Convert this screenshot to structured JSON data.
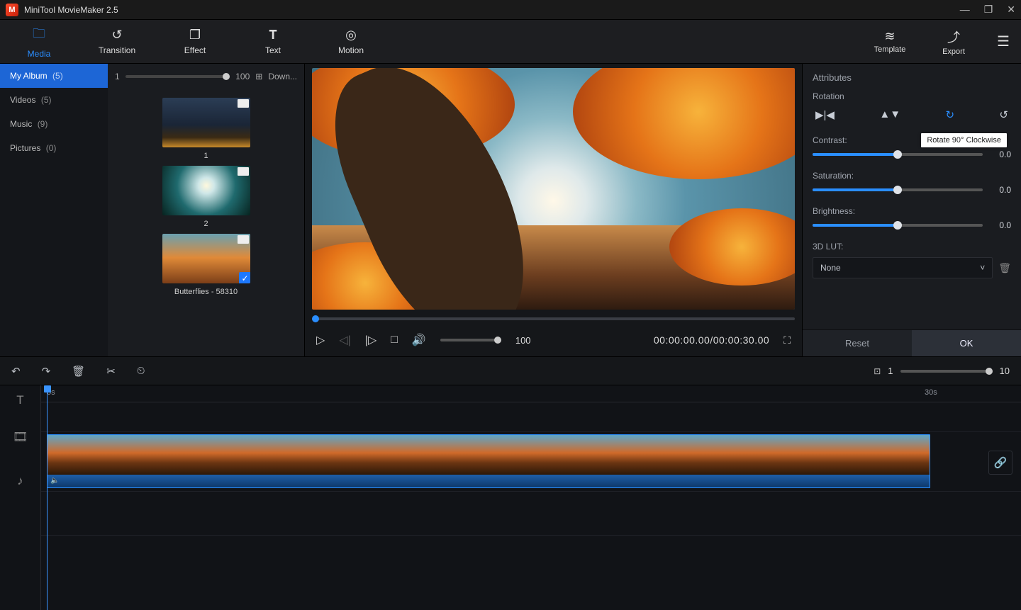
{
  "app": {
    "title": "MiniTool MovieMaker 2.5"
  },
  "tabs": {
    "media": {
      "label": "Media"
    },
    "transition": {
      "label": "Transition"
    },
    "effect": {
      "label": "Effect"
    },
    "text": {
      "label": "Text"
    },
    "motion": {
      "label": "Motion"
    }
  },
  "rightcmds": {
    "template": {
      "label": "Template"
    },
    "export": {
      "label": "Export"
    }
  },
  "sidebar": {
    "items": [
      {
        "label": "My Album",
        "count": "(5)"
      },
      {
        "label": "Videos",
        "count": "(5)"
      },
      {
        "label": "Music",
        "count": "(9)"
      },
      {
        "label": "Pictures",
        "count": "(0)"
      }
    ]
  },
  "mediaheader": {
    "left": "1",
    "percent": "100",
    "dl": "Down..."
  },
  "thumbs": [
    {
      "caption": "1"
    },
    {
      "caption": "2"
    },
    {
      "caption": "Butterflies - 58310",
      "selected": true
    }
  ],
  "player": {
    "volume": "100",
    "timecode": "00:00:00.00/00:00:30.00"
  },
  "attributes": {
    "panel_title": "Attributes",
    "rotation_label": "Rotation",
    "tooltip": "Rotate 90° Clockwise",
    "contrast": {
      "label": "Contrast:",
      "value": "0.0"
    },
    "saturation": {
      "label": "Saturation:",
      "value": "0.0"
    },
    "brightness": {
      "label": "Brightness:",
      "value": "0.0"
    },
    "lut_label": "3D LUT:",
    "lut_value": "None",
    "reset": "Reset",
    "ok": "OK"
  },
  "zoom": {
    "left": "1",
    "right": "10"
  },
  "ruler": {
    "start": "0s",
    "end": "30s"
  }
}
